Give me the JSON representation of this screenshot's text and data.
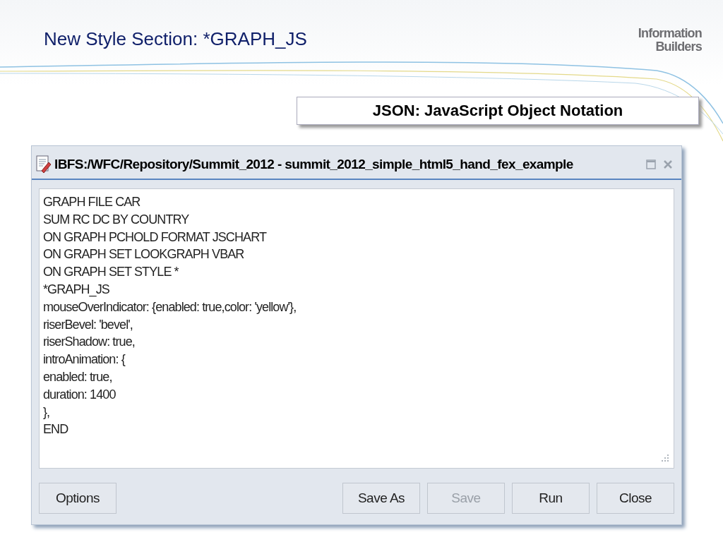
{
  "slide_title": "New Style Section: *GRAPH_JS",
  "logo": {
    "line_1": "Information",
    "line_2": "Builders"
  },
  "callout": "JSON: JavaScript Object Notation",
  "dialog": {
    "title": "IBFS:/WFC/Repository/Summit_2012 - summit_2012_simple_html5_hand_fex_example",
    "code_lines": [
      "GRAPH FILE CAR",
      "SUM RC DC BY COUNTRY",
      "ON GRAPH PCHOLD FORMAT JSCHART",
      "ON GRAPH SET LOOKGRAPH VBAR",
      "ON GRAPH SET STYLE *",
      "*GRAPH_JS",
      "mouseOverIndicator: {enabled: true,color: 'yellow'},",
      "riserBevel: 'bevel',",
      "riserShadow: true,",
      "introAnimation: {",
      "enabled: true,",
      "duration: 1400",
      "},",
      "END"
    ],
    "buttons": [
      {
        "label": "Options",
        "disabled": false,
        "kind": "left"
      },
      {
        "label": "Save As",
        "disabled": false,
        "kind": "right"
      },
      {
        "label": "Save",
        "disabled": true,
        "kind": "right"
      },
      {
        "label": "Run",
        "disabled": false,
        "kind": "right"
      },
      {
        "label": "Close",
        "disabled": false,
        "kind": "right"
      }
    ]
  }
}
